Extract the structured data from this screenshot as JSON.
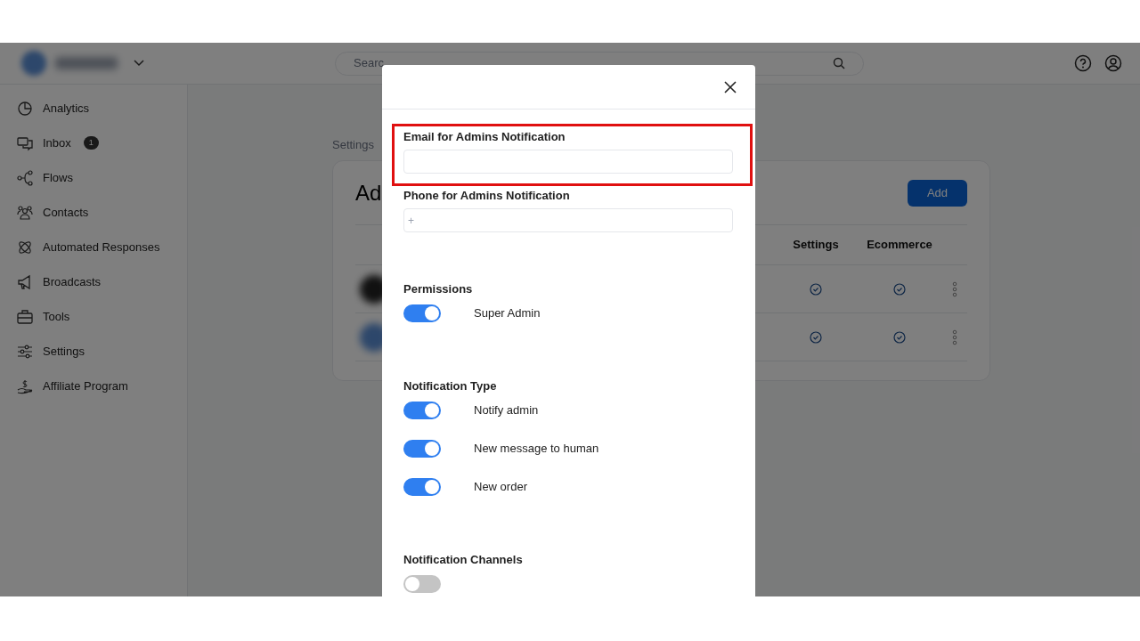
{
  "header": {
    "search": {
      "placeholder": "Searc"
    }
  },
  "sidebar": {
    "items": [
      {
        "label": "Analytics"
      },
      {
        "label": "Inbox",
        "badge": "1"
      },
      {
        "label": "Flows"
      },
      {
        "label": "Contacts"
      },
      {
        "label": "Automated Responses"
      },
      {
        "label": "Broadcasts"
      },
      {
        "label": "Tools"
      },
      {
        "label": "Settings"
      },
      {
        "label": "Affiliate Program"
      }
    ]
  },
  "breadcrumb": "Settings",
  "page_title": "Ad",
  "add_button": "Add",
  "table": {
    "columns": [
      "Settings",
      "Ecommerce"
    ],
    "rows": [
      {
        "settings": true,
        "ecommerce": true
      },
      {
        "settings": true,
        "ecommerce": true
      }
    ]
  },
  "modal": {
    "email": {
      "label": "Email for Admins Notification"
    },
    "phone": {
      "label": "Phone for Admins Notification",
      "placeholder": "+"
    },
    "sections": [
      {
        "title": "Permissions",
        "toggles": [
          {
            "label": "Super Admin",
            "on": true
          }
        ]
      },
      {
        "title": "Notification Type",
        "toggles": [
          {
            "label": "Notify admin",
            "on": true
          },
          {
            "label": "New message to human",
            "on": true
          },
          {
            "label": "New order",
            "on": true
          }
        ]
      },
      {
        "title": "Notification Channels",
        "toggles": [
          {
            "on": false
          }
        ]
      }
    ]
  }
}
